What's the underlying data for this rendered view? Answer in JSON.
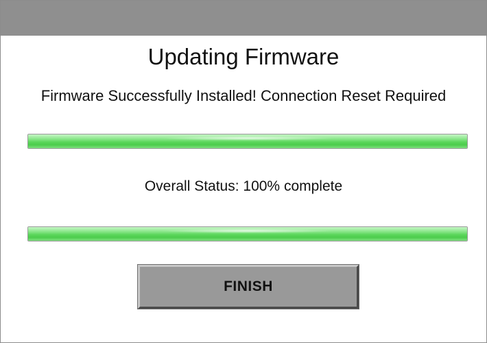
{
  "dialog": {
    "title": "Updating Firmware",
    "message": "Firmware Successfully Installed! Connection Reset Required",
    "status_text": "Overall Status: 100% complete",
    "progress_bars": [
      {
        "value_percent": 100
      },
      {
        "value_percent": 100
      }
    ],
    "finish_label": "FINISH"
  },
  "colors": {
    "titlebar": "#8f8f8f",
    "progress_green": "#5cd65c",
    "button_gray": "#999999"
  }
}
